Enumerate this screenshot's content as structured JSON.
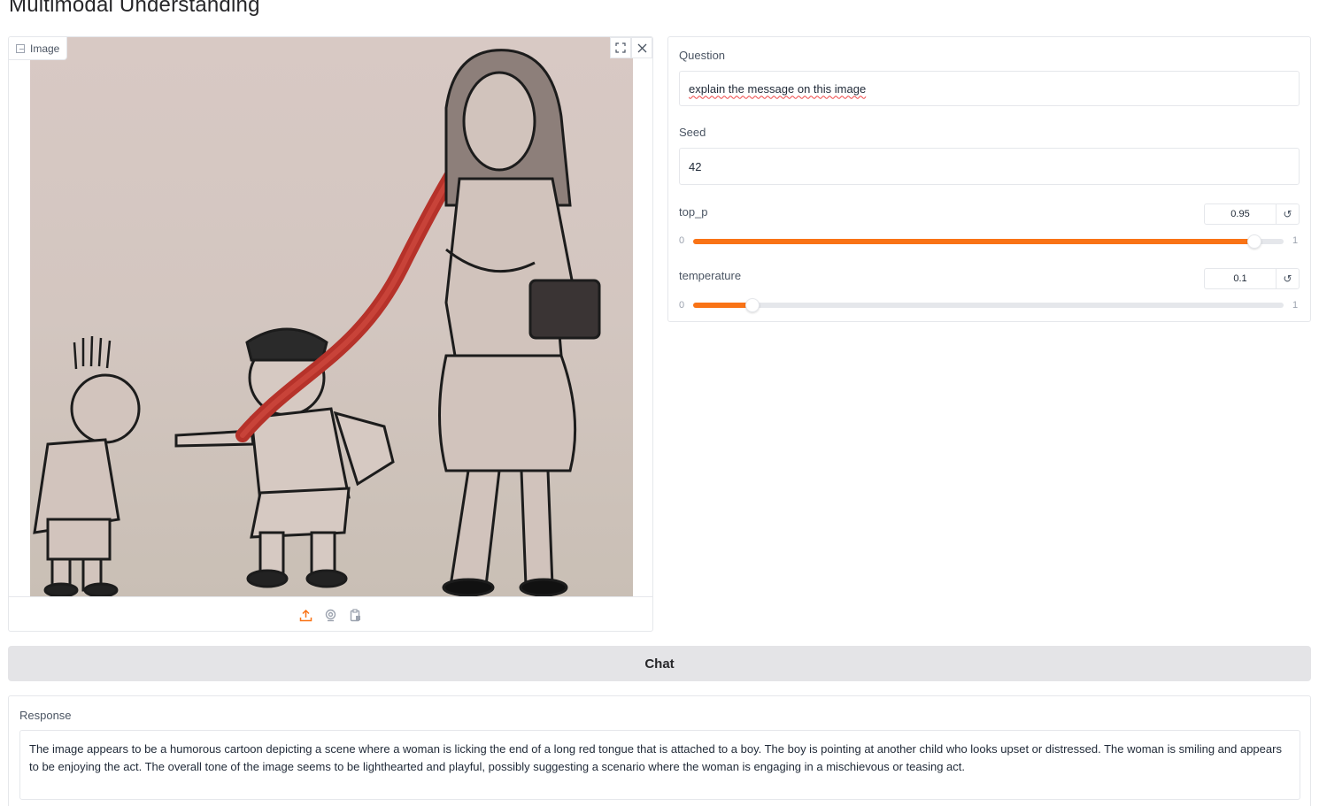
{
  "page_title": "Multimodal Understanding",
  "image_panel": {
    "label": "Image",
    "tools": {
      "fullscreen_icon": "fullscreen-icon",
      "close_icon": "close-icon"
    },
    "sources": [
      "upload-icon",
      "webcam-icon",
      "clipboard-icon"
    ],
    "accent": "#f97316"
  },
  "question": {
    "label": "Question",
    "value": "explain the message on this image"
  },
  "seed": {
    "label": "Seed",
    "value": "42"
  },
  "top_p": {
    "label": "top_p",
    "value": "0.95",
    "min": "0",
    "max": "1",
    "fraction": 0.95
  },
  "temperature": {
    "label": "temperature",
    "value": "0.1",
    "min": "0",
    "max": "1",
    "fraction": 0.1
  },
  "chat_button": {
    "label": "Chat"
  },
  "response": {
    "label": "Response",
    "text": "The image appears to be a humorous cartoon depicting a scene where a woman is licking the end of a long red tongue that is attached to a boy. The boy is pointing at another child who looks upset or distressed. The woman is smiling and appears to be enjoying the act. The overall tone of the image seems to be lighthearted and playful, possibly suggesting a scenario where the woman is engaging in a mischievous or teasing act."
  },
  "colors": {
    "accent": "#f97316",
    "button_bg": "#e4e4e7",
    "border": "#e5e7eb"
  }
}
